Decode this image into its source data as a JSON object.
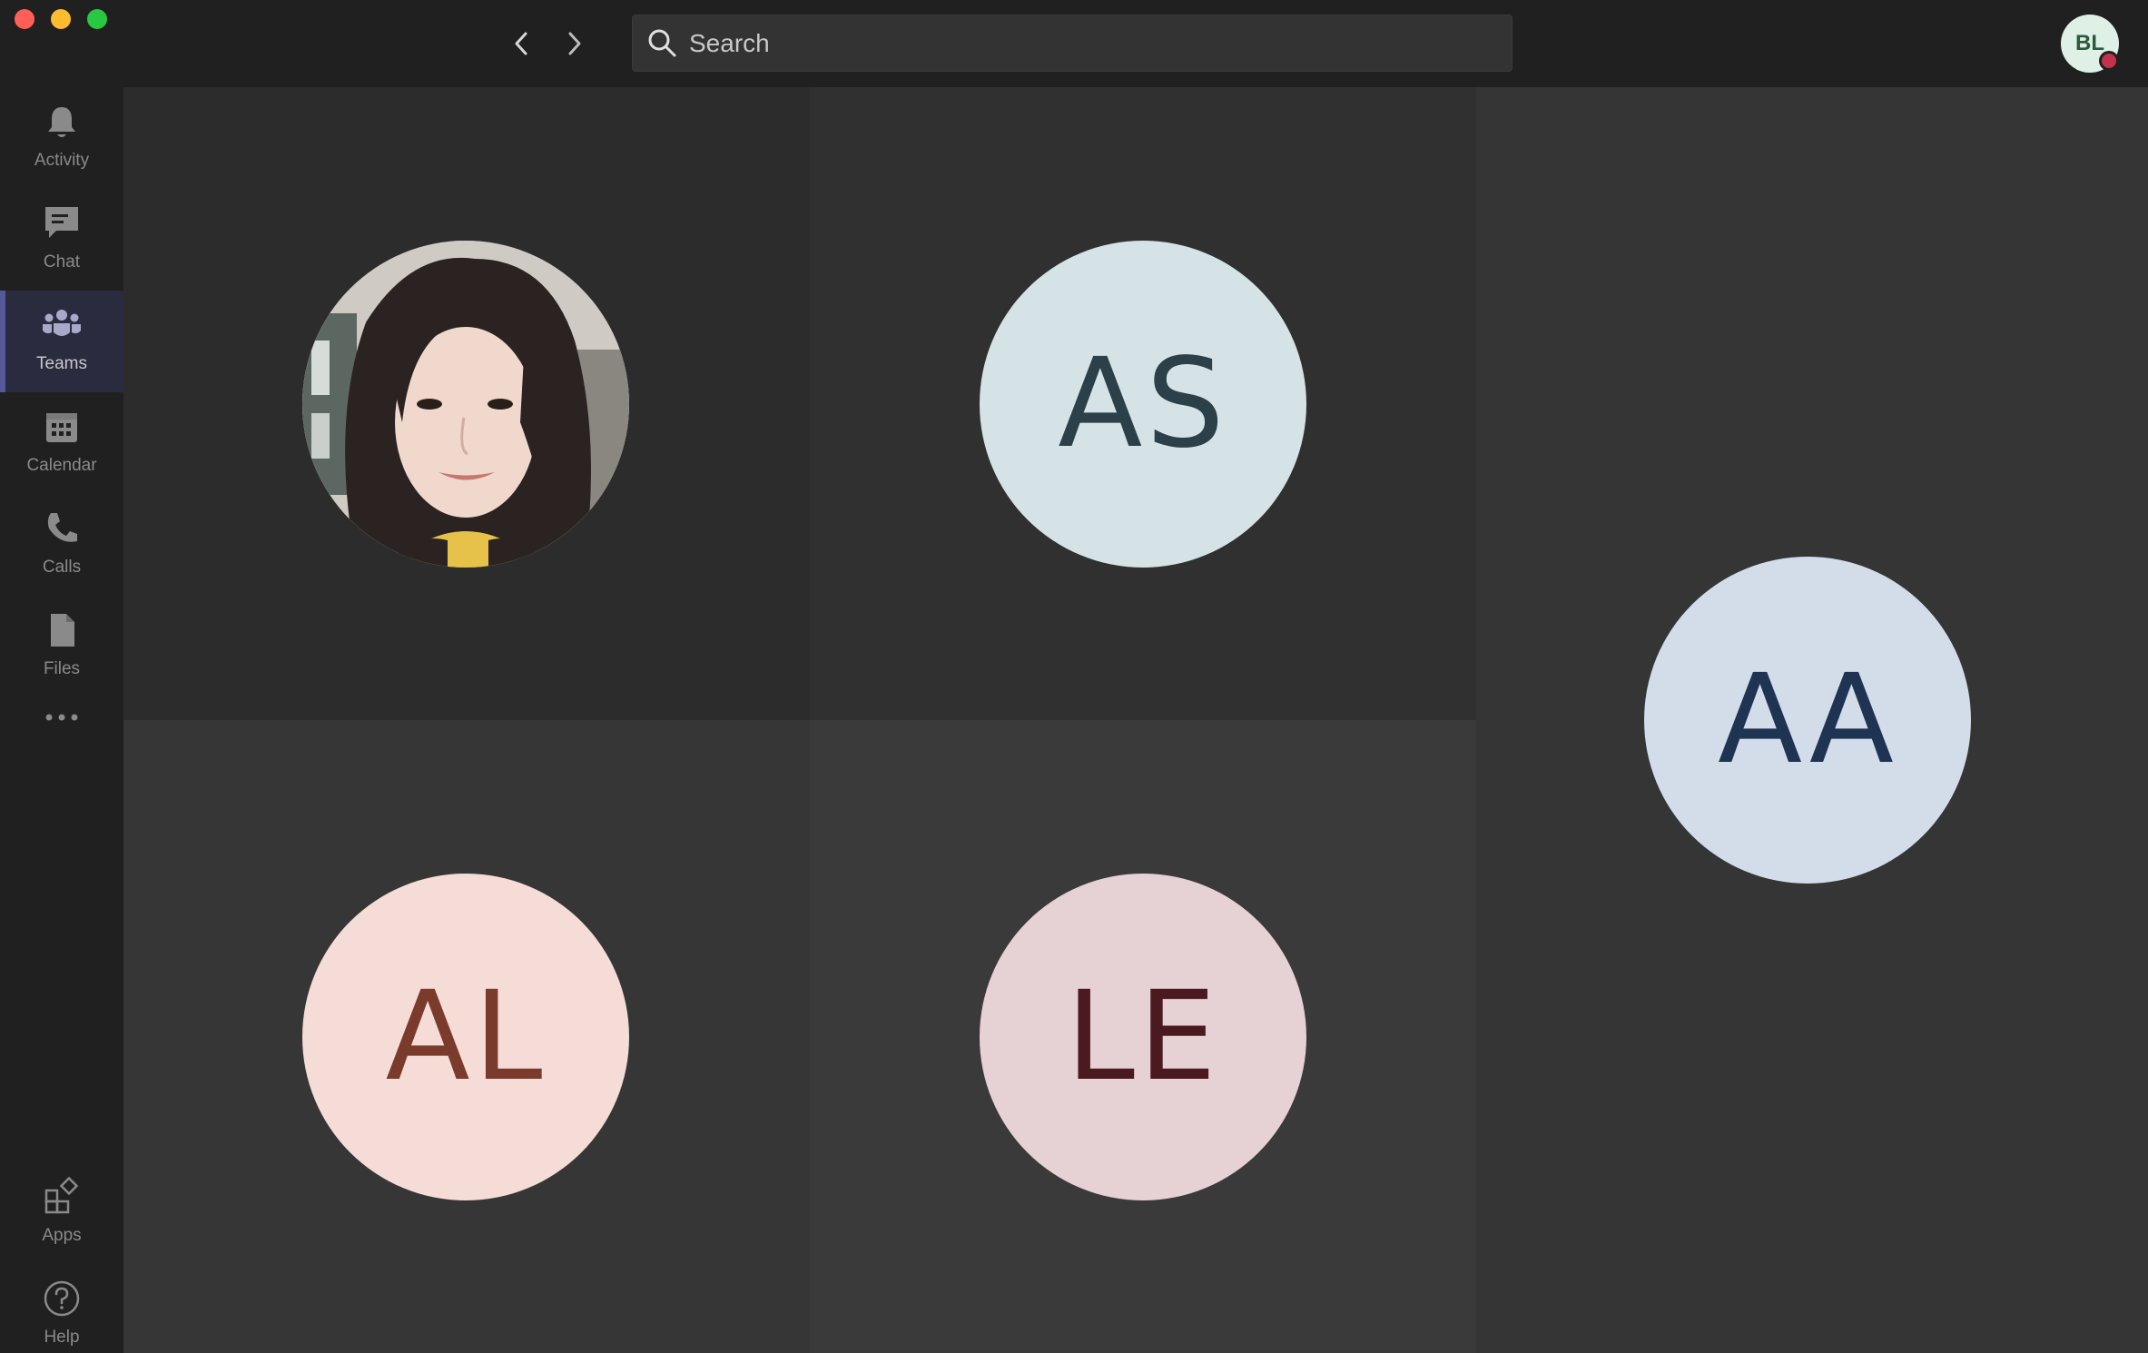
{
  "window": {
    "traffic_lights": [
      "close",
      "minimize",
      "maximize"
    ],
    "colors": {
      "close": "#ff5f57",
      "minimize": "#febc2e",
      "maximize": "#28c840"
    }
  },
  "titlebar": {
    "back_icon": "chevron-left-icon",
    "forward_icon": "chevron-right-icon",
    "search": {
      "placeholder": "Search",
      "value": ""
    },
    "me": {
      "initials": "BL",
      "presence": "busy",
      "presence_color": "#c4314b"
    }
  },
  "rail": {
    "items": [
      {
        "label": "Activity",
        "icon": "bell-icon",
        "active": false
      },
      {
        "label": "Chat",
        "icon": "chat-icon",
        "active": false
      },
      {
        "label": "Teams",
        "icon": "teams-icon",
        "active": true
      },
      {
        "label": "Calendar",
        "icon": "calendar-icon",
        "active": false
      },
      {
        "label": "Calls",
        "icon": "phone-icon",
        "active": false
      },
      {
        "label": "Files",
        "icon": "file-icon",
        "active": false
      }
    ],
    "more_icon": "more-icon",
    "bottom_items": [
      {
        "label": "Apps",
        "icon": "apps-icon"
      },
      {
        "label": "Help",
        "icon": "help-icon"
      }
    ]
  },
  "stage": {
    "participants": [
      {
        "type": "photo",
        "initials": "",
        "bg": "#dcdcdc",
        "fg": "#000000"
      },
      {
        "type": "initials",
        "initials": "AS",
        "bg": "#d6e3e6",
        "fg": "#2b4048"
      },
      {
        "type": "initials",
        "initials": "AA",
        "bg": "#d2dde9",
        "fg": "#1f3453"
      },
      {
        "type": "initials",
        "initials": "AL",
        "bg": "#f5dcd7",
        "fg": "#7a3a2c"
      },
      {
        "type": "initials",
        "initials": "LE",
        "bg": "#e6d1d4",
        "fg": "#4a1a20"
      }
    ]
  }
}
